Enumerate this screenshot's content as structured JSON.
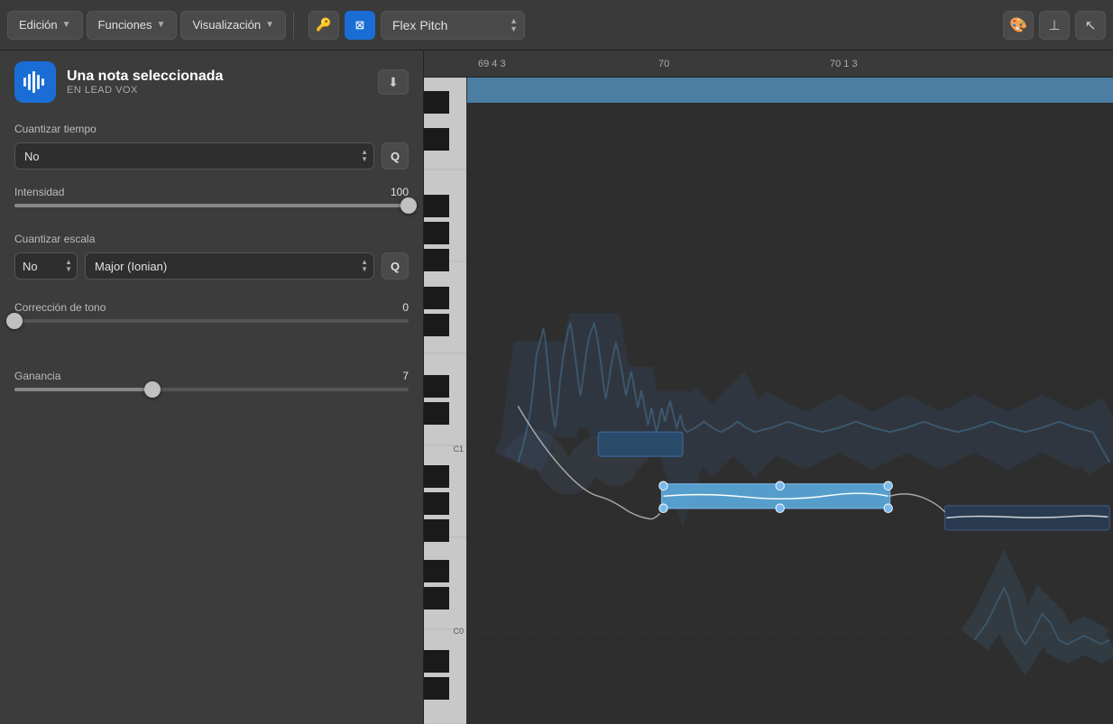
{
  "toolbar": {
    "edicion_label": "Edición",
    "funciones_label": "Funciones",
    "visualizacion_label": "Visualización",
    "flex_pitch_label": "Flex Pitch",
    "timeline_marks": [
      "69 4 3",
      "70",
      "70 1 3"
    ]
  },
  "left_panel": {
    "icon_symbol": "≋",
    "title": "Una nota seleccionada",
    "subtitle": "en LEAD VOX",
    "download_icon": "⬇",
    "cuantizar_tiempo_label": "Cuantizar tiempo",
    "cuantizar_tiempo_value": "No",
    "q_button": "Q",
    "intensidad_label": "Intensidad",
    "intensidad_value": "100",
    "intensidad_slider_pct": 100,
    "cuantizar_escala_label": "Cuantizar escala",
    "cuantizar_escala_no": "No",
    "cuantizar_escala_scale": "Major (Ionian)",
    "correccion_label": "Corrección de tono",
    "correccion_value": "0",
    "correccion_slider_pct": 0,
    "ganancia_label": "Ganancia",
    "ganancia_value": "7",
    "ganancia_slider_pct": 35
  },
  "piano": {
    "c1_label": "C1",
    "c0_label": "C0"
  }
}
